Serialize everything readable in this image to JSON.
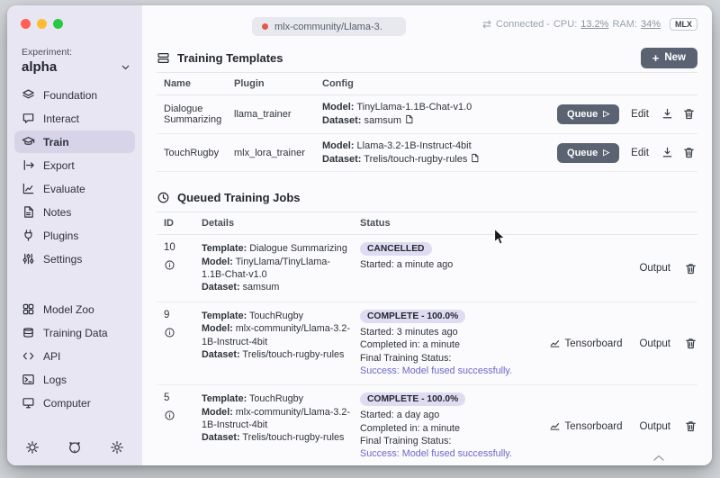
{
  "chrome": {
    "model_badge": "mlx-community/Llama-3.",
    "connected": "Connected -",
    "cpu_label": "CPU:",
    "cpu_value": "13.2%",
    "ram_label": "RAM:",
    "ram_value": "34%",
    "engine": "MLX"
  },
  "icons": {
    "play": "▷",
    "connected": "⇄",
    "plus": "+"
  },
  "sidebar": {
    "experiment_label": "Experiment:",
    "experiment_name": "alpha",
    "primary": [
      {
        "label": "Foundation"
      },
      {
        "label": "Interact"
      },
      {
        "label": "Train"
      },
      {
        "label": "Export"
      },
      {
        "label": "Evaluate"
      },
      {
        "label": "Notes"
      },
      {
        "label": "Plugins"
      },
      {
        "label": "Settings"
      }
    ],
    "secondary": [
      {
        "label": "Model Zoo"
      },
      {
        "label": "Training Data"
      },
      {
        "label": "API"
      },
      {
        "label": "Logs"
      },
      {
        "label": "Computer"
      }
    ]
  },
  "labels": {
    "template": "Template:",
    "model": "Model:",
    "dataset": "Dataset:",
    "queue": "Queue",
    "edit": "Edit",
    "new": "New",
    "output": "Output",
    "tensorboard": "Tensorboard",
    "final_status": "Final Training Status:"
  },
  "templates_section": {
    "title": "Training Templates",
    "columns": [
      "Name",
      "Plugin",
      "Config"
    ],
    "rows": [
      {
        "name": "Dialogue Summarizing",
        "plugin": "llama_trainer",
        "model": "TinyLlama-1.1B-Chat-v1.0",
        "dataset": "samsum"
      },
      {
        "name": "TouchRugby",
        "plugin": "mlx_lora_trainer",
        "model": "Llama-3.2-1B-Instruct-4bit",
        "dataset": "Trelis/touch-rugby-rules"
      }
    ]
  },
  "jobs_section": {
    "title": "Queued Training Jobs",
    "columns": [
      "ID",
      "Details",
      "Status"
    ],
    "rows": [
      {
        "id": "10",
        "template": "Dialogue Summarizing",
        "model": "TinyLlama/TinyLlama-1.1B-Chat-v1.0",
        "dataset": "samsum",
        "badge": "CANCELLED",
        "started": "Started: a minute ago"
      },
      {
        "id": "9",
        "template": "TouchRugby",
        "model": "mlx-community/Llama-3.2-1B-Instruct-4bit",
        "dataset": "Trelis/touch-rugby-rules",
        "badge": "COMPLETE - 100.0%",
        "started": "Started: 3 minutes ago",
        "completed": "Completed in: a minute",
        "final": "Success: Model fused successfully."
      },
      {
        "id": "5",
        "template": "TouchRugby",
        "model": "mlx-community/Llama-3.2-1B-Instruct-4bit",
        "dataset": "Trelis/touch-rugby-rules",
        "badge": "COMPLETE - 100.0%",
        "started": "Started: a day ago",
        "completed": "Completed in: a minute",
        "final": "Success: Model fused successfully."
      }
    ]
  }
}
